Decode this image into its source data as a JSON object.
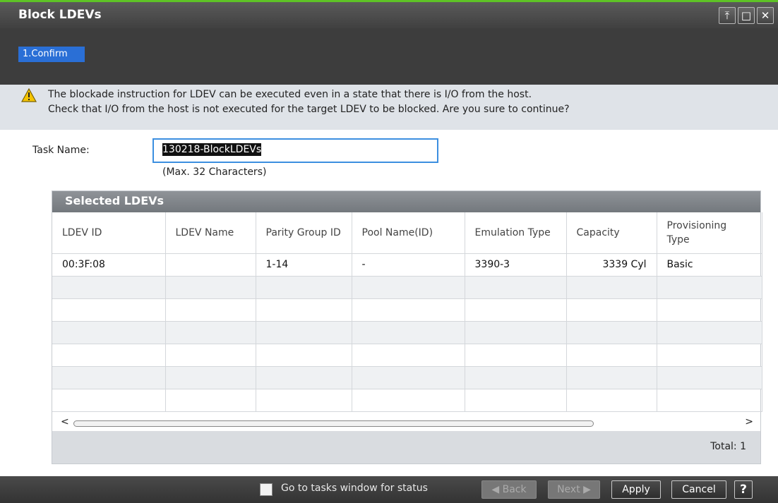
{
  "window": {
    "title": "Block LDEVs",
    "buttons": {
      "pin": "⤒",
      "maximize": "□",
      "close": "✕"
    }
  },
  "steps": {
    "current": "1.Confirm"
  },
  "warning": {
    "line1": "The blockade instruction for LDEV can be executed even in a state that there is I/O from the host.",
    "line2": "Check that I/O from the host is not executed for the target LDEV to be blocked. Are you sure to continue?"
  },
  "task": {
    "label": "Task Name:",
    "value": "130218-BlockLDEVs",
    "hint": "(Max. 32 Characters)"
  },
  "table": {
    "title": "Selected LDEVs",
    "columns": [
      "LDEV ID",
      "LDEV Name",
      "Parity Group ID",
      "Pool Name(ID)",
      "Emulation Type",
      "Capacity",
      "Provisioning Type"
    ],
    "rows": [
      [
        "00:3F:08",
        "",
        "1-14",
        "-",
        "3390-3",
        "3339 Cyl",
        "Basic"
      ]
    ],
    "scroll_left": "<",
    "scroll_right": ">",
    "total": "Total:  1"
  },
  "footer": {
    "checkbox_label": "Go to tasks window for status",
    "back": "◀ Back",
    "next": "Next ▶",
    "apply": "Apply",
    "cancel": "Cancel",
    "help": "?"
  },
  "colors": {
    "accent": "#5ec326",
    "step_active": "#2a6fd6",
    "focus": "#3c8fe0"
  }
}
